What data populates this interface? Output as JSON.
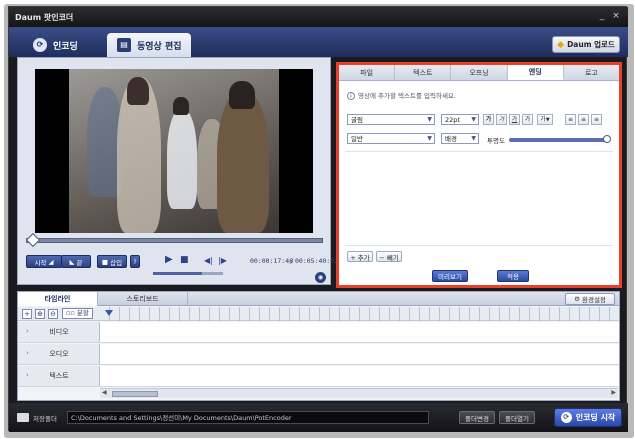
{
  "window": {
    "title": "Daum 팟인코더",
    "minimize": "_",
    "close": "×"
  },
  "modes": {
    "encoding": {
      "label": "인코딩",
      "icon": "encode-icon"
    },
    "edit": {
      "label": "동영상 편집",
      "icon": "film-icon"
    },
    "upload": {
      "label": "Daum 업로드",
      "icon": "star-icon"
    }
  },
  "preview": {
    "mark_in_label": "시작",
    "mark_out_label": "끝",
    "insert_label": "삽입",
    "help_label": "?",
    "current_time": "00:00:17:46",
    "separator": "/",
    "total_time": "00:05:40:02"
  },
  "edit_panel": {
    "tabs": [
      "파일",
      "텍스트",
      "오프닝",
      "엔딩",
      "로고"
    ],
    "active_tab": "엔딩",
    "hint": "영상에 추가할 텍스트를 입력하세요.",
    "font": "굴림",
    "font_size": "22pt",
    "format_buttons": [
      "가",
      "가",
      "가",
      "가",
      "가"
    ],
    "style": "일반",
    "background": "배경",
    "transparency_label": "투명도",
    "add_label": "+ 추가",
    "remove_label": "− 빼기",
    "preview_label": "미리보기",
    "apply_label": "적용"
  },
  "timeline": {
    "tabs": [
      "타임라인",
      "스토리보드"
    ],
    "env_label": "환경설정",
    "split_label": "분할",
    "tracks": [
      "비디오",
      "오디오",
      "텍스트"
    ]
  },
  "bottom": {
    "save_folder_label": "저장폴더",
    "path": "C:\\Documents and Settings\\정선미\\My Documents\\Daum\\PotEncoder",
    "change_folder_label": "폴더변경",
    "open_folder_label": "폴더열기",
    "start_encoding_label": "인코딩 시작"
  }
}
